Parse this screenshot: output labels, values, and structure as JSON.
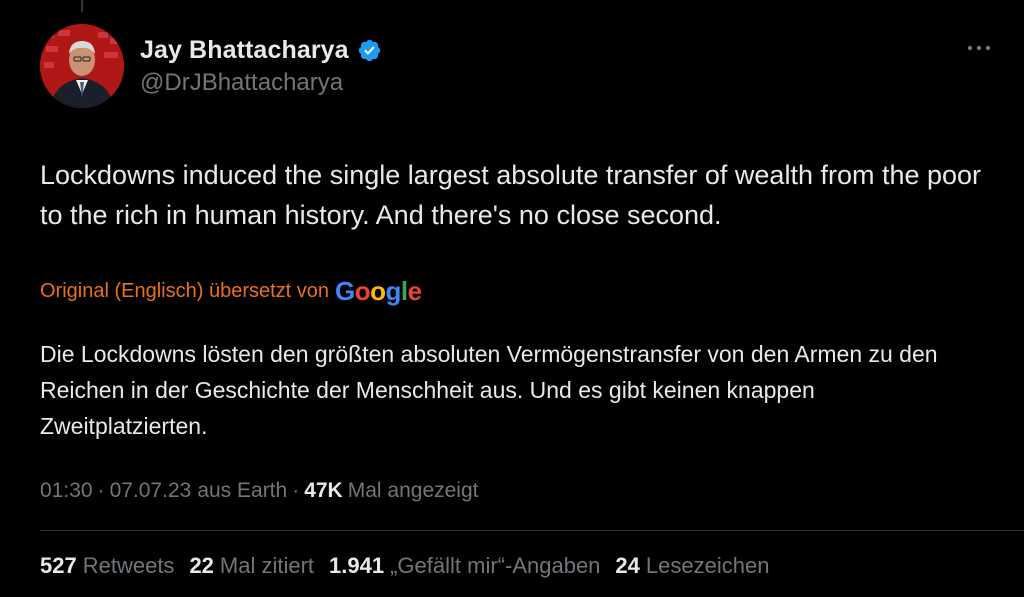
{
  "author": {
    "display_name": "Jay Bhattacharya",
    "handle": "@DrJBhattacharya",
    "verified": true,
    "verified_color": "#1d9bf0"
  },
  "tweet": {
    "text": "Lockdowns induced the single largest absolute transfer of wealth from the poor to the rich in human history. And there's no close second.",
    "translation_label": "Original (Englisch) übersetzt von",
    "translation_provider": "Google",
    "translated_text": "Die Lockdowns lösten den größten absoluten Vermögenstransfer von den Armen zu den Reichen in der Geschichte der Menschheit aus. Und es gibt keinen knappen Zweitplatzierten."
  },
  "meta": {
    "time": "01:30",
    "separator": "·",
    "date": "07.07.23",
    "location": "aus Earth",
    "views_count": "47K",
    "views_label": "Mal angezeigt"
  },
  "stats": [
    {
      "count": "527",
      "label": "Retweets"
    },
    {
      "count": "22",
      "label": "Mal zitiert"
    },
    {
      "count": "1.941",
      "label": "„Gefällt mir“-Angaben"
    },
    {
      "count": "24",
      "label": "Lesezeichen"
    }
  ],
  "colors": {
    "background": "#000000",
    "primary_text": "#e7e9ea",
    "secondary_text": "#71767b",
    "translation_accent": "#e9711c",
    "avatar_bg": "#b01818"
  },
  "icons": {
    "verified": "verified-badge-icon",
    "more": "more-horizontal-icon"
  }
}
